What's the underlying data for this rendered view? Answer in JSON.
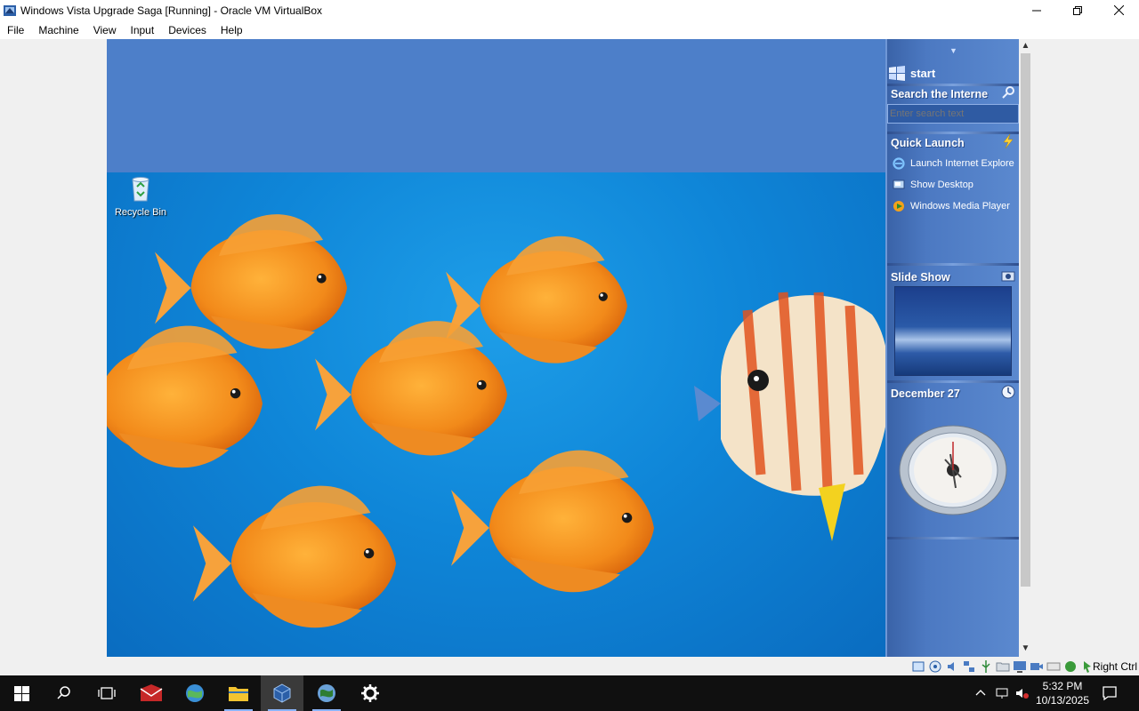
{
  "window": {
    "title": "Windows Vista Upgrade Saga [Running] - Oracle VM VirtualBox"
  },
  "menu": {
    "items": [
      "File",
      "Machine",
      "View",
      "Input",
      "Devices",
      "Help"
    ]
  },
  "desktop": {
    "recycle_bin_label": "Recycle Bin"
  },
  "sidebar": {
    "start_label": "start",
    "search_title": "Search the Interne",
    "search_placeholder": "Enter search text",
    "quick_launch_title": "Quick Launch",
    "links": [
      {
        "label": "Launch Internet Explore",
        "icon": "ie-icon"
      },
      {
        "label": "Show Desktop",
        "icon": "show-desktop-icon"
      },
      {
        "label": "Windows Media Player",
        "icon": "media-player-icon"
      }
    ],
    "slideshow_title": "Slide Show",
    "date_title": "December 27"
  },
  "statusbar": {
    "host_key": "Right Ctrl"
  },
  "taskbar": {
    "time": "5:32 PM",
    "date": "10/13/2025"
  },
  "colors": {
    "guest_sky": "#4d7fc9",
    "water": "#0f86d8",
    "sidebar": "#4c79c2",
    "taskbar": "#101010",
    "fish_orange": "#f28a1a"
  }
}
